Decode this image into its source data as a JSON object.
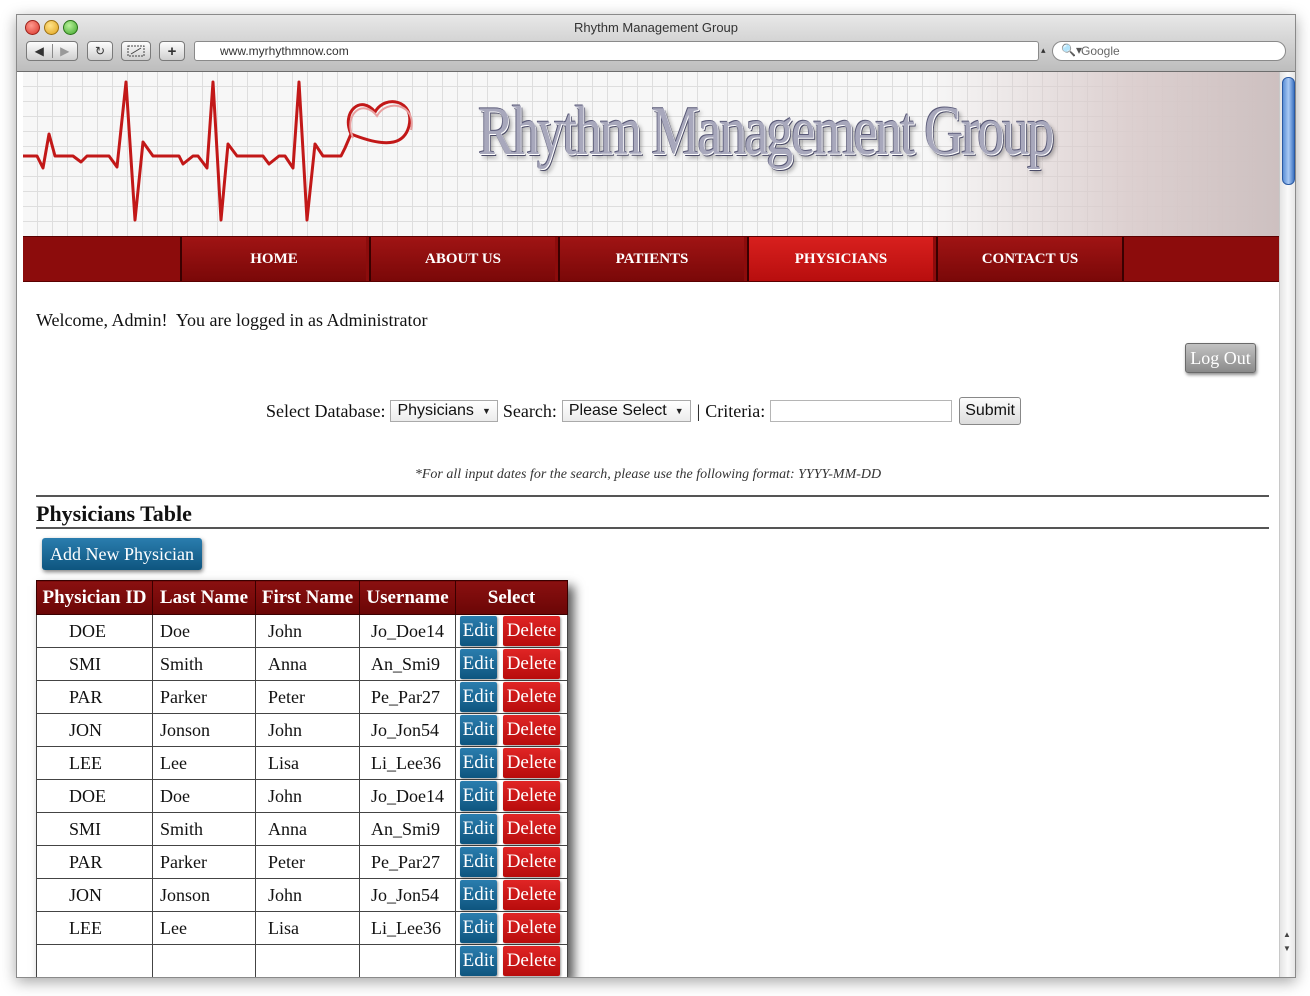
{
  "browser": {
    "window_title": "Rhythm Management Group",
    "url": "www.myrhythmnow.com",
    "search_placeholder": "Google"
  },
  "site": {
    "banner_title": "Rhythm Management Group"
  },
  "nav": {
    "items": [
      {
        "label": "HOME",
        "active": false
      },
      {
        "label": "ABOUT US",
        "active": false
      },
      {
        "label": "PATIENTS",
        "active": false
      },
      {
        "label": "PHYSICIANS",
        "active": true
      },
      {
        "label": "CONTACT US",
        "active": false
      }
    ]
  },
  "session": {
    "welcome": "Welcome, Admin!  You are logged in as Administrator",
    "logout_label": "Log Out"
  },
  "search": {
    "db_label": "Select Database:",
    "db_value": "Physicians",
    "search_label": "Search:",
    "search_value": "Please Select",
    "separator": "|",
    "criteria_label": "Criteria:",
    "criteria_value": "",
    "submit_label": "Submit",
    "date_note": "*For all input dates for the search, please use the following format: YYYY-MM-DD"
  },
  "table": {
    "title": "Physicians Table",
    "add_label": "Add New Physician",
    "headers": [
      "Physician ID",
      "Last Name",
      "First Name",
      "Username",
      "Select"
    ],
    "edit_label": "Edit",
    "delete_label": "Delete",
    "rows": [
      [
        "DOE",
        "Doe",
        "John",
        "Jo_Doe14"
      ],
      [
        "SMI",
        "Smith",
        "Anna",
        "An_Smi9"
      ],
      [
        "PAR",
        "Parker",
        "Peter",
        "Pe_Par27"
      ],
      [
        "JON",
        "Jonson",
        "John",
        "Jo_Jon54"
      ],
      [
        "LEE",
        "Lee",
        "Lisa",
        "Li_Lee36"
      ],
      [
        "DOE",
        "Doe",
        "John",
        "Jo_Doe14"
      ],
      [
        "SMI",
        "Smith",
        "Anna",
        "An_Smi9"
      ],
      [
        "PAR",
        "Parker",
        "Peter",
        "Pe_Par27"
      ],
      [
        "JON",
        "Jonson",
        "John",
        "Jo_Jon54"
      ],
      [
        "LEE",
        "Lee",
        "Lisa",
        "Li_Lee36"
      ],
      [
        "",
        "",
        "",
        ""
      ]
    ]
  },
  "colors": {
    "nav_bg": "#8c0c0c",
    "nav_active": "#c8140f",
    "edit_blue": "#1a6a99",
    "delete_red": "#c91414"
  }
}
